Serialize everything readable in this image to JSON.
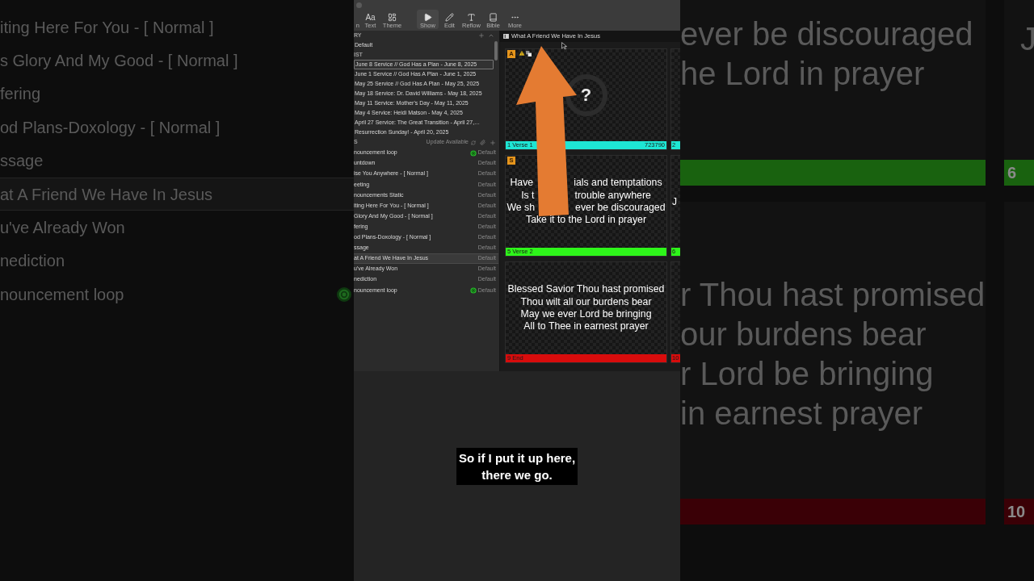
{
  "backdrop_left": {
    "items": [
      {
        "title": "iting Here For You - [ Normal  ]",
        "selected": false,
        "live": false
      },
      {
        "title": "s Glory And My Good - [ Normal ]",
        "selected": false,
        "live": false
      },
      {
        "title": "fering",
        "selected": false,
        "live": false
      },
      {
        "title": "od Plans-Doxology - [ Normal ]",
        "selected": false,
        "live": false
      },
      {
        "title": "ssage",
        "selected": false,
        "live": false
      },
      {
        "title": "at A Friend We Have In Jesus",
        "selected": true,
        "live": false
      },
      {
        "title": "u've Already Won",
        "selected": false,
        "live": false
      },
      {
        "title": "nediction",
        "selected": false,
        "live": false
      },
      {
        "title": "nouncement loop",
        "selected": false,
        "live": true
      }
    ]
  },
  "toolbar": {
    "buttons": [
      {
        "kind": "cut",
        "label": "n",
        "selected": false
      },
      {
        "kind": "text",
        "glyph": "Aa",
        "label": "Text",
        "selected": false
      },
      {
        "kind": "theme",
        "label": "Theme",
        "selected": false
      },
      {
        "kind": "show",
        "label": "Show",
        "selected": true
      },
      {
        "kind": "edit",
        "label": "Edit",
        "selected": false
      },
      {
        "kind": "reflow",
        "label": "Reflow",
        "selected": false
      },
      {
        "kind": "bible",
        "label": "Bible",
        "selected": false
      },
      {
        "kind": "more",
        "label": "More",
        "selected": false
      }
    ]
  },
  "library": {
    "header": "RY",
    "items": [
      "Default"
    ]
  },
  "playlist": {
    "header": "IST",
    "items": [
      {
        "title": "June 8 Service // God Has a Plan - June 8, 2025",
        "selected": true
      },
      {
        "title": "June 1 Service // God Has A Plan - June 1, 2025",
        "selected": false
      },
      {
        "title": "May 25 Service // God Has A Plan - May 25, 2025",
        "selected": false
      },
      {
        "title": "May 18 Service: Dr. David Williams - May 18, 2025",
        "selected": false
      },
      {
        "title": "May 11 Service: Mother's Day - May 11, 2025",
        "selected": false
      },
      {
        "title": "May 4 Service: Heidi Matson - May 4, 2025",
        "selected": false
      },
      {
        "title": "April 27 Service: The Great Transition - April 27,…",
        "selected": false
      },
      {
        "title": "Resurrection Sunday! - April 20, 2025",
        "selected": false
      }
    ]
  },
  "presentations": {
    "header": "S",
    "status": "Update Available",
    "items": [
      {
        "title": "nouncement loop",
        "arrangement": "Default",
        "selected": false,
        "live": true
      },
      {
        "title": "untdown",
        "arrangement": "Default",
        "selected": false,
        "live": false
      },
      {
        "title": "ise You Anywhere - [ Normal ]",
        "arrangement": "Default",
        "selected": false,
        "live": false
      },
      {
        "title": "eeting",
        "arrangement": "Default",
        "selected": false,
        "live": false
      },
      {
        "title": "nouncements Static",
        "arrangement": "Default",
        "selected": false,
        "live": false
      },
      {
        "title": "iting Here For You - [ Normal  ]",
        "arrangement": "Default",
        "selected": false,
        "live": false
      },
      {
        "title": "Glory And My Good - [ Normal ]",
        "arrangement": "Default",
        "selected": false,
        "live": false
      },
      {
        "title": "fering",
        "arrangement": "Default",
        "selected": false,
        "live": false
      },
      {
        "title": "od Plans-Doxology - [ Normal ]",
        "arrangement": "Default",
        "selected": false,
        "live": false
      },
      {
        "title": "ssage",
        "arrangement": "Default",
        "selected": false,
        "live": false
      },
      {
        "title": "at A Friend We Have In Jesus",
        "arrangement": "Default",
        "selected": true,
        "live": false
      },
      {
        "title": "u've Already Won",
        "arrangement": "Default",
        "selected": false,
        "live": false
      },
      {
        "title": "nediction",
        "arrangement": "Default",
        "selected": false,
        "live": false
      },
      {
        "title": "nouncement loop",
        "arrangement": "Default",
        "selected": false,
        "live": true
      }
    ]
  },
  "editor": {
    "title": "What A Friend We Have In Jesus",
    "slides": [
      {
        "number": "1",
        "label": "Verse 1",
        "code": "723790",
        "color": "#1ee6d4",
        "badge": "A",
        "warning": true,
        "missing_media": true,
        "placeholder_glyph": "?",
        "next": {
          "number": "2",
          "color": "#1ee6d4"
        }
      },
      {
        "number": "5",
        "label": "Verse 2",
        "color": "#2ef51a",
        "badge": "S",
        "warning": false,
        "missing_media": false,
        "lines": [
          [
            "Have",
            "ials and temptations"
          ],
          [
            "Is t",
            "trouble anywhere"
          ],
          [
            "We sh",
            "ever be discouraged"
          ],
          [
            "Take it to the Lord in prayer"
          ]
        ],
        "next": {
          "number": "6",
          "color": "#2ef51a",
          "peek": "J"
        }
      },
      {
        "number": "9",
        "label": "End",
        "color": "#d80c0c",
        "warning": false,
        "missing_media": false,
        "lines": [
          [
            "Blessed Savior Thou hast promised"
          ],
          [
            "Thou wilt all our burdens bear"
          ],
          [
            "May we ever Lord be bringing"
          ],
          [
            "All to Thee in earnest prayer"
          ]
        ],
        "next": {
          "number": "10",
          "color": "#d80c0c"
        }
      }
    ]
  },
  "caption": {
    "lines": [
      "So if I put it up here,",
      "there we go."
    ]
  },
  "backdrop_right": {
    "cards": [
      {
        "lines": [
          "ever be discouraged",
          "he Lord in prayer"
        ],
        "color": "#19620f",
        "next_number": "6",
        "next_peek": "J"
      },
      {
        "lines": [
          "r Thou hast promised",
          "our burdens bear",
          "r Lord be bringing",
          "in earnest prayer"
        ],
        "color": "#3a0006",
        "next_number": "10"
      }
    ]
  }
}
